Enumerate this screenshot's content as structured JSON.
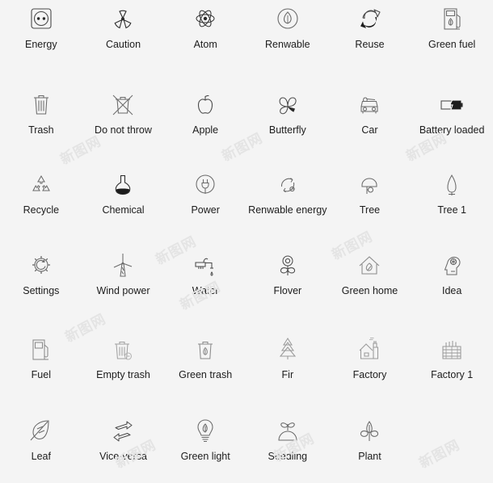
{
  "page": {
    "background_color": "#f4f4f4",
    "icon_stroke_color": "#4a4a4a",
    "label_color": "#1c1c1c",
    "columns": 6,
    "rows": 6,
    "total_icons": 35
  },
  "watermark": {
    "text": "新图网",
    "color": "#e4e4e4",
    "occurrences": 8
  },
  "icons": [
    {
      "label": "Energy",
      "icon": "power-socket-icon"
    },
    {
      "label": "Caution",
      "icon": "radiation-warning-icon"
    },
    {
      "label": "Atom",
      "icon": "atom-icon"
    },
    {
      "label": "Renwable",
      "icon": "renewable-leaf-drop-icon"
    },
    {
      "label": "Reuse",
      "icon": "reuse-arrows-icon"
    },
    {
      "label": "Green fuel",
      "icon": "green-fuel-pump-icon"
    },
    {
      "label": "Trash",
      "icon": "trash-can-icon"
    },
    {
      "label": "Do not throw",
      "icon": "do-not-throw-icon"
    },
    {
      "label": "Apple",
      "icon": "apple-icon"
    },
    {
      "label": "Butterfly",
      "icon": "butterfly-icon"
    },
    {
      "label": "Car",
      "icon": "car-icon"
    },
    {
      "label": "Battery loaded",
      "icon": "battery-loaded-icon"
    },
    {
      "label": "Recycle",
      "icon": "recycle-triangle-icon"
    },
    {
      "label": "Chemical",
      "icon": "chemical-flask-icon"
    },
    {
      "label": "Power",
      "icon": "power-plug-icon"
    },
    {
      "label": "Renwable energy",
      "icon": "renewable-energy-cycle-icon"
    },
    {
      "label": "Tree",
      "icon": "tree-icon"
    },
    {
      "label": "Tree 1",
      "icon": "tree-1-icon"
    },
    {
      "label": "Settings",
      "icon": "settings-gear-icon"
    },
    {
      "label": "Wind power",
      "icon": "wind-turbine-icon"
    },
    {
      "label": "Water",
      "icon": "water-tap-icon"
    },
    {
      "label": "Flover",
      "icon": "flower-icon"
    },
    {
      "label": "Green home",
      "icon": "green-home-icon"
    },
    {
      "label": "Idea",
      "icon": "idea-head-icon"
    },
    {
      "label": "Fuel",
      "icon": "fuel-pump-icon"
    },
    {
      "label": "Empty trash",
      "icon": "empty-trash-icon"
    },
    {
      "label": "Green trash",
      "icon": "green-trash-icon"
    },
    {
      "label": "Fir",
      "icon": "fir-tree-icon"
    },
    {
      "label": "Factory",
      "icon": "factory-icon"
    },
    {
      "label": "Factory 1",
      "icon": "factory-1-icon"
    },
    {
      "label": "Leaf",
      "icon": "leaf-icon"
    },
    {
      "label": "Vice-versa",
      "icon": "vice-versa-arrows-icon"
    },
    {
      "label": "Green light",
      "icon": "green-light-bulb-icon"
    },
    {
      "label": "Seedling",
      "icon": "seedling-icon"
    },
    {
      "label": "Plant",
      "icon": "plant-icon"
    }
  ]
}
